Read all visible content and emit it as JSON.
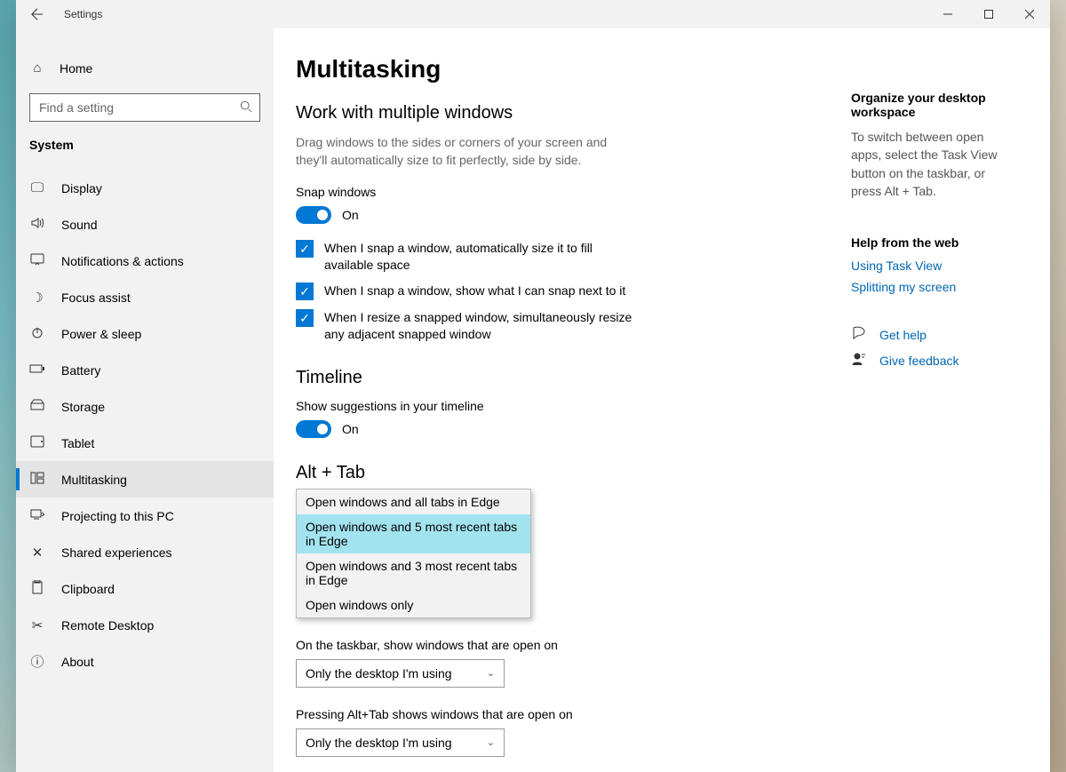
{
  "app": {
    "title": "Settings"
  },
  "sidebar": {
    "home": "Home",
    "search_placeholder": "Find a setting",
    "category": "System",
    "items": [
      {
        "label": "Display"
      },
      {
        "label": "Sound"
      },
      {
        "label": "Notifications & actions"
      },
      {
        "label": "Focus assist"
      },
      {
        "label": "Power & sleep"
      },
      {
        "label": "Battery"
      },
      {
        "label": "Storage"
      },
      {
        "label": "Tablet"
      },
      {
        "label": "Multitasking"
      },
      {
        "label": "Projecting to this PC"
      },
      {
        "label": "Shared experiences"
      },
      {
        "label": "Clipboard"
      },
      {
        "label": "Remote Desktop"
      },
      {
        "label": "About"
      }
    ]
  },
  "main": {
    "page_title": "Multitasking",
    "windows": {
      "heading": "Work with multiple windows",
      "desc": "Drag windows to the sides or corners of your screen and they'll automatically size to fit perfectly, side by side.",
      "snap_label": "Snap windows",
      "snap_state": "On",
      "check1": "When I snap a window, automatically size it to fill available space",
      "check2": "When I snap a window, show what I can snap next to it",
      "check3": "When I resize a snapped window, simultaneously resize any adjacent snapped window"
    },
    "timeline": {
      "heading": "Timeline",
      "label": "Show suggestions in your timeline",
      "state": "On"
    },
    "alttab": {
      "heading": "Alt + Tab",
      "options": [
        "Open windows and all tabs in Edge",
        "Open windows and 5 most recent tabs in Edge",
        "Open windows and 3 most recent tabs in Edge",
        "Open windows only"
      ]
    },
    "taskbar_label": "On the taskbar, show windows that are open on",
    "taskbar_value": "Only the desktop I'm using",
    "alttab_label": "Pressing Alt+Tab shows windows that are open on",
    "alttab_value": "Only the desktop I'm using"
  },
  "rail": {
    "organize_heading": "Organize your desktop workspace",
    "organize_text": "To switch between open apps, select the Task View button on the taskbar, or press Alt + Tab.",
    "help_heading": "Help from the web",
    "link1": "Using Task View",
    "link2": "Splitting my screen",
    "get_help": "Get help",
    "give_feedback": "Give feedback"
  }
}
